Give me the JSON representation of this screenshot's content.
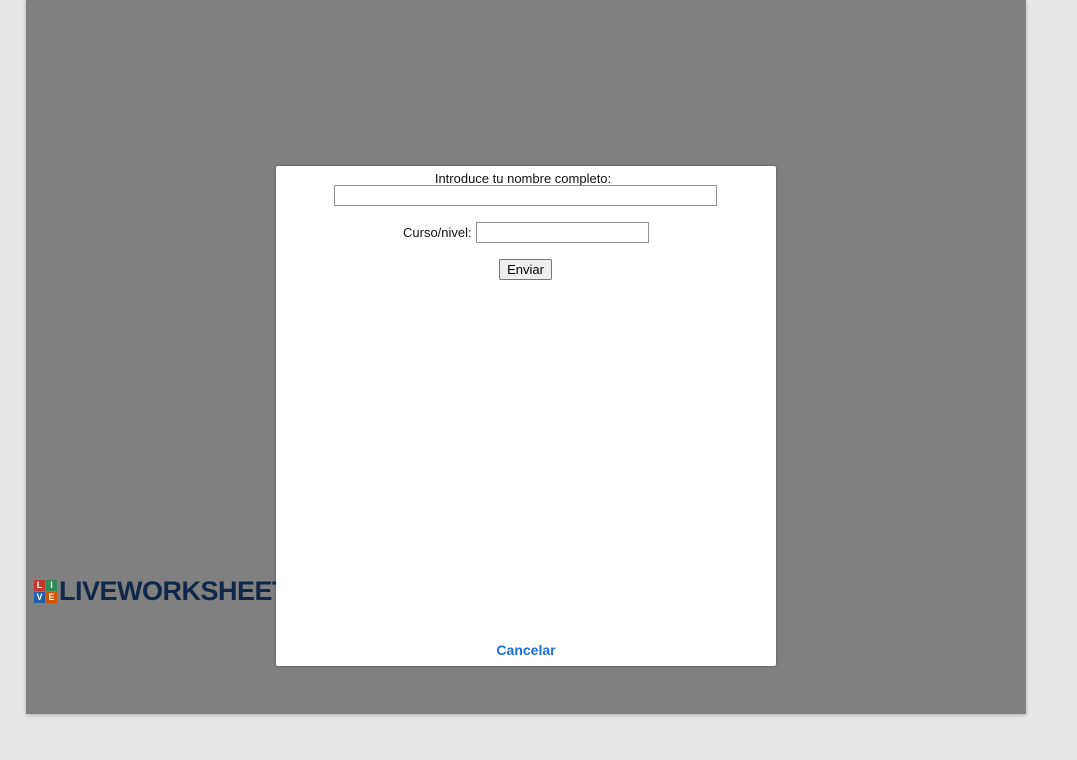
{
  "logo": {
    "squares": [
      {
        "letter": "L",
        "color": "#c0392b"
      },
      {
        "letter": "I",
        "color": "#2e8b57"
      },
      {
        "letter": "V",
        "color": "#1f5fa8"
      },
      {
        "letter": "E",
        "color": "#d35400"
      }
    ],
    "text": "LIVEWORKSHEET"
  },
  "modal": {
    "name_label": "Introduce tu nombre completo:",
    "name_value": "",
    "course_label": "Curso/nivel:",
    "course_value": "",
    "send_label": "Enviar",
    "cancel_label": "Cancelar"
  },
  "colors": {
    "overlay": "#808080",
    "link": "#1a6ed8",
    "logo_text": "#0f2748"
  }
}
